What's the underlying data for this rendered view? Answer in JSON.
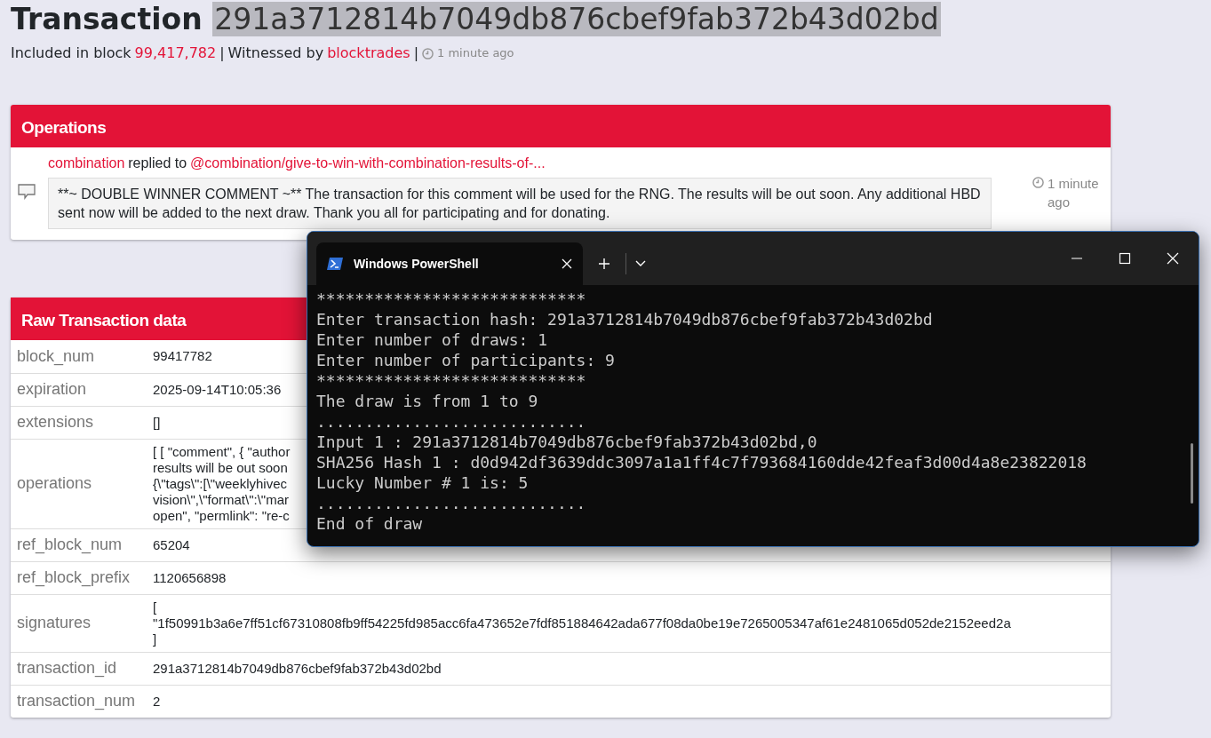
{
  "header": {
    "title": "Transaction",
    "hash": "291a3712814b7049db876cbef9fab372b43d02bd",
    "included_label": "Included in block",
    "block": "99,417,782",
    "separator": "|",
    "witnessed_label": "Witnessed by",
    "witness": "blocktrades",
    "separator_2": "|",
    "time": "1 minute ago"
  },
  "operations": {
    "title": "Operations",
    "items": [
      {
        "author": "combination",
        "action": "replied to",
        "target": "@combination/give-to-win-with-combination-results-of-...",
        "body": "**~ DOUBLE WINNER COMMENT ~** The transaction for this comment will be used for the RNG. The results will be out soon. Any additional HBD sent now will be added to the next draw. Thank you all for participating and for donating.",
        "time": "1 minute ago"
      }
    ]
  },
  "raw": {
    "title": "Raw Transaction data",
    "rows": [
      {
        "key": "block_num",
        "lines": [
          "99417782"
        ]
      },
      {
        "key": "expiration",
        "lines": [
          "2025-09-14T10:05:36"
        ]
      },
      {
        "key": "extensions",
        "lines": [
          "[]"
        ]
      },
      {
        "key": "operations",
        "lines": [
          "[ [ \"comment\", { \"author",
          "results will be out soon",
          "{\\\"tags\\\":[\\\"weeklyhivec",
          "vision\\\",\\\"format\\\":\\\"mar",
          "open\", \"permlink\": \"re-c"
        ]
      },
      {
        "key": "ref_block_num",
        "lines": [
          "65204"
        ]
      },
      {
        "key": "ref_block_prefix",
        "lines": [
          "1120656898"
        ]
      },
      {
        "key": "signatures",
        "lines": [
          "[",
          "\"1f50991b3a6e7ff51cf67310808fb9ff54225fd985acc6fa473652e7fdf851884642ada677f08da0be19e7265005347af61e2481065d052de2152eed2a",
          "]"
        ]
      },
      {
        "key": "transaction_id",
        "lines": [
          "291a3712814b7049db876cbef9fab372b43d02bd"
        ]
      },
      {
        "key": "transaction_num",
        "lines": [
          "2"
        ]
      }
    ]
  },
  "terminal": {
    "tab_title": "Windows PowerShell",
    "lines": [
      "****************************",
      "Enter transaction hash: 291a3712814b7049db876cbef9fab372b43d02bd",
      "Enter number of draws: 1",
      "Enter number of participants: 9",
      "****************************",
      "The draw is from 1 to 9",
      "............................",
      "Input 1 : 291a3712814b7049db876cbef9fab372b43d02bd,0",
      "SHA256 Hash 1 : d0d942df3639ddc3097a1a1ff4c7f793684160dde42feaf3d00d4a8e23822018",
      "Lucky Number # 1 is: 5",
      "............................",
      "End of draw"
    ]
  }
}
